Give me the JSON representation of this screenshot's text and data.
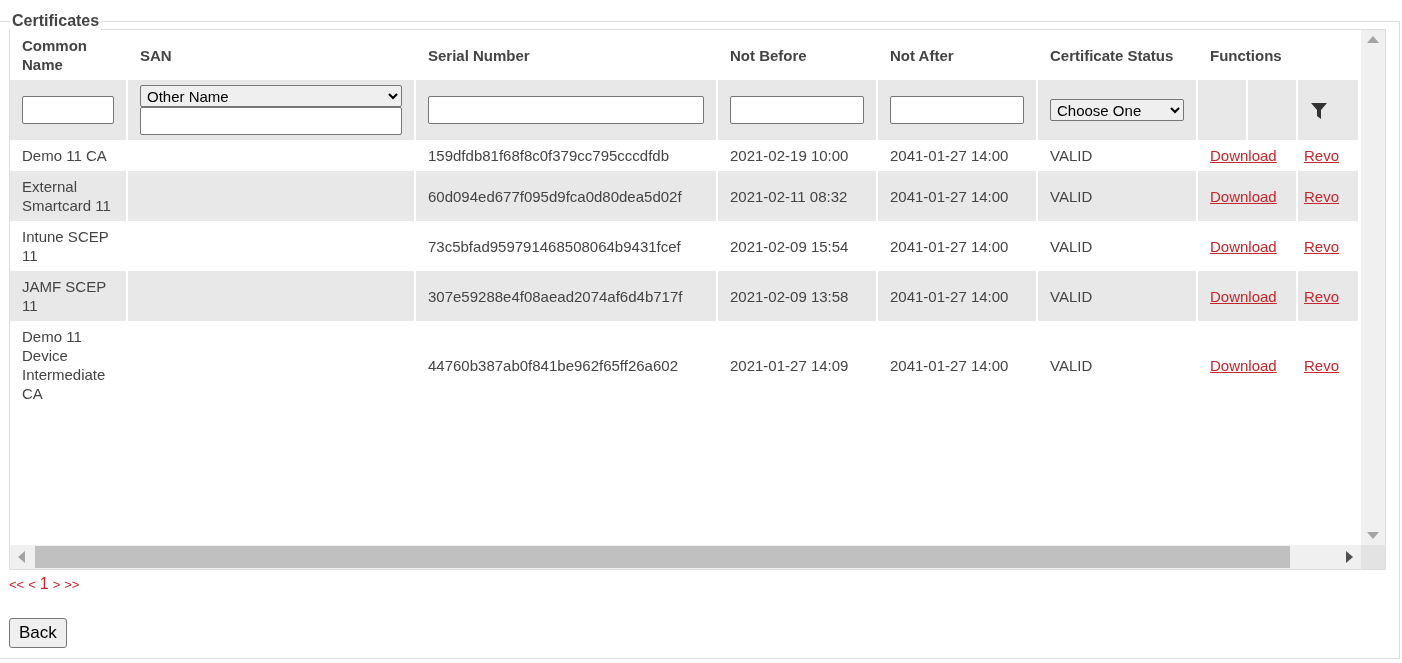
{
  "section": {
    "title": "Certificates"
  },
  "table": {
    "columns": [
      "Common Name",
      "SAN",
      "Serial Number",
      "Not Before",
      "Not After",
      "Certificate Status",
      "Functions"
    ],
    "filters": {
      "san_type": "Other Name",
      "status": "Choose One"
    },
    "rows": [
      {
        "common_name": "Demo 11 CA",
        "serial": "159dfdb81f68f8c0f379cc795cccdfdb",
        "not_before": "2021-02-19 10:00",
        "not_after": "2041-01-27 14:00",
        "status": "VALID",
        "actions": [
          "Download",
          "Revo"
        ]
      },
      {
        "common_name": "External Smartcard 11",
        "serial": "60d094ed677f095d9fca0d80dea5d02f",
        "not_before": "2021-02-11 08:32",
        "not_after": "2041-01-27 14:00",
        "status": "VALID",
        "actions": [
          "Download",
          "Revo"
        ]
      },
      {
        "common_name": "Intune SCEP 11",
        "serial": "73c5bfad959791468508064b9431fcef",
        "not_before": "2021-02-09 15:54",
        "not_after": "2041-01-27 14:00",
        "status": "VALID",
        "actions": [
          "Download",
          "Revo"
        ]
      },
      {
        "common_name": "JAMF SCEP 11",
        "serial": "307e59288e4f08aead2074af6d4b717f",
        "not_before": "2021-02-09 13:58",
        "not_after": "2041-01-27 14:00",
        "status": "VALID",
        "actions": [
          "Download",
          "Revo"
        ]
      },
      {
        "common_name": "Demo 11 Device Intermediate CA",
        "serial": "44760b387ab0f841be962f65ff26a602",
        "not_before": "2021-01-27 14:09",
        "not_after": "2041-01-27 14:00",
        "status": "VALID",
        "actions": [
          "Download",
          "Revo"
        ]
      }
    ]
  },
  "pager": [
    {
      "label": "<<",
      "selected": false
    },
    {
      "label": "<",
      "selected": false
    },
    {
      "label": "1",
      "selected": true
    },
    {
      "label": ">",
      "selected": false
    },
    {
      "label": ">>",
      "selected": false
    }
  ],
  "buttons": [
    "Back"
  ]
}
